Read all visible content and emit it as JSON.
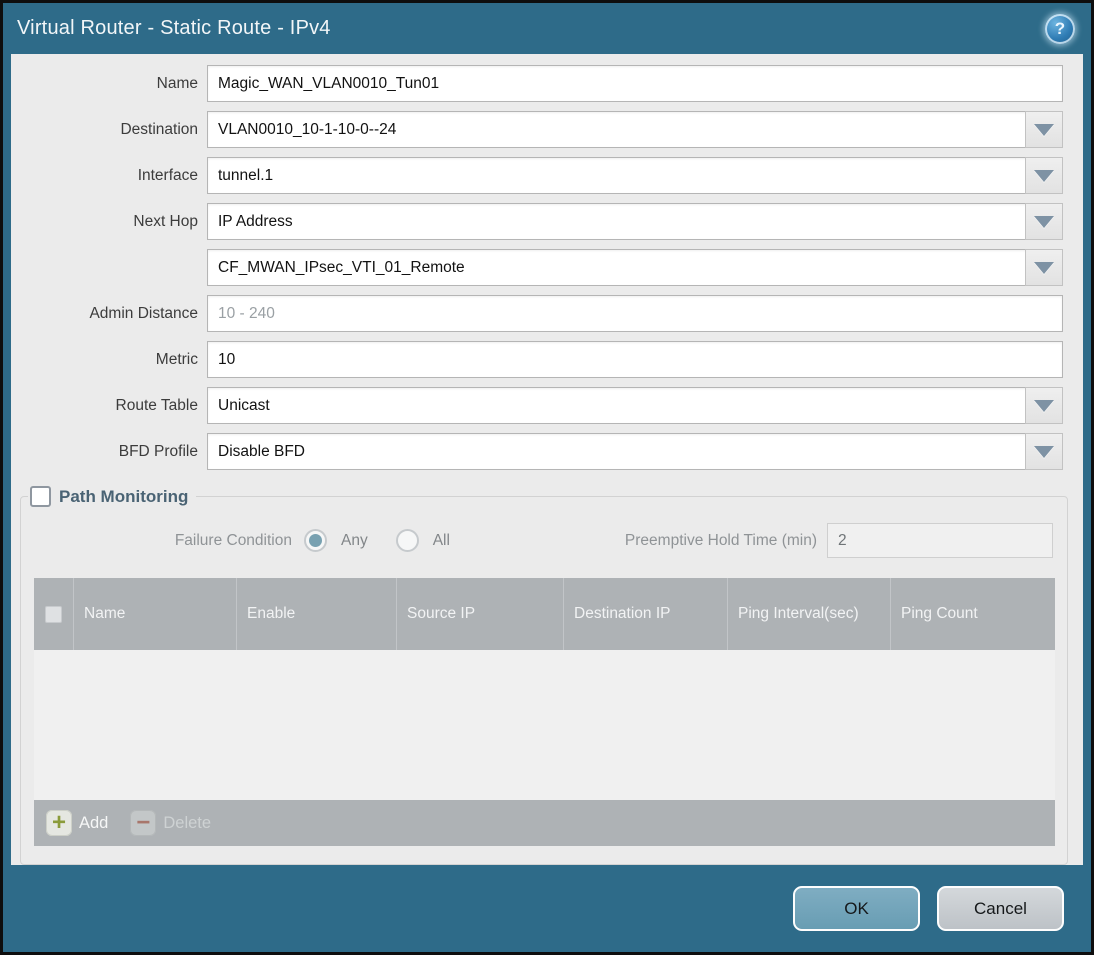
{
  "window": {
    "title": "Virtual Router - Static Route - IPv4"
  },
  "icons": {
    "help": "?",
    "dropdown_arrow": "triangle-down",
    "add": "+",
    "delete": "−"
  },
  "colors": {
    "frame_teal": "#2e6b89",
    "content_bg": "#ebebeb",
    "table_header_bg": "#aeb2b5",
    "ok_button": "#74a7bd",
    "cancel_button": "#c9cdd2",
    "radio_selected": "#78a1b1",
    "add_icon_green": "#8a9b3a",
    "delete_icon_red": "#a8766b"
  },
  "form": {
    "name": {
      "label": "Name",
      "value": "Magic_WAN_VLAN0010_Tun01"
    },
    "destination": {
      "label": "Destination",
      "value": "VLAN0010_10-1-10-0--24"
    },
    "interface": {
      "label": "Interface",
      "value": "tunnel.1"
    },
    "next_hop": {
      "label": "Next Hop",
      "value": "IP Address"
    },
    "next_hop_address": {
      "value": "CF_MWAN_IPsec_VTI_01_Remote"
    },
    "admin_distance": {
      "label": "Admin Distance",
      "placeholder": "10 - 240",
      "value": ""
    },
    "metric": {
      "label": "Metric",
      "value": "10"
    },
    "route_table": {
      "label": "Route Table",
      "value": "Unicast"
    },
    "bfd_profile": {
      "label": "BFD Profile",
      "value": "Disable BFD"
    }
  },
  "path_monitoring": {
    "title": "Path Monitoring",
    "enabled": false,
    "failure_condition": {
      "label": "Failure Condition",
      "options": [
        "Any",
        "All"
      ],
      "selected": "Any"
    },
    "preemptive_hold_time": {
      "label": "Preemptive Hold Time (min)",
      "value": "2"
    },
    "table": {
      "columns": [
        "Name",
        "Enable",
        "Source IP",
        "Destination IP",
        "Ping Interval(sec)",
        "Ping Count"
      ],
      "rows": []
    },
    "actions": {
      "add": "Add",
      "delete": "Delete"
    }
  },
  "footer": {
    "ok": "OK",
    "cancel": "Cancel"
  }
}
